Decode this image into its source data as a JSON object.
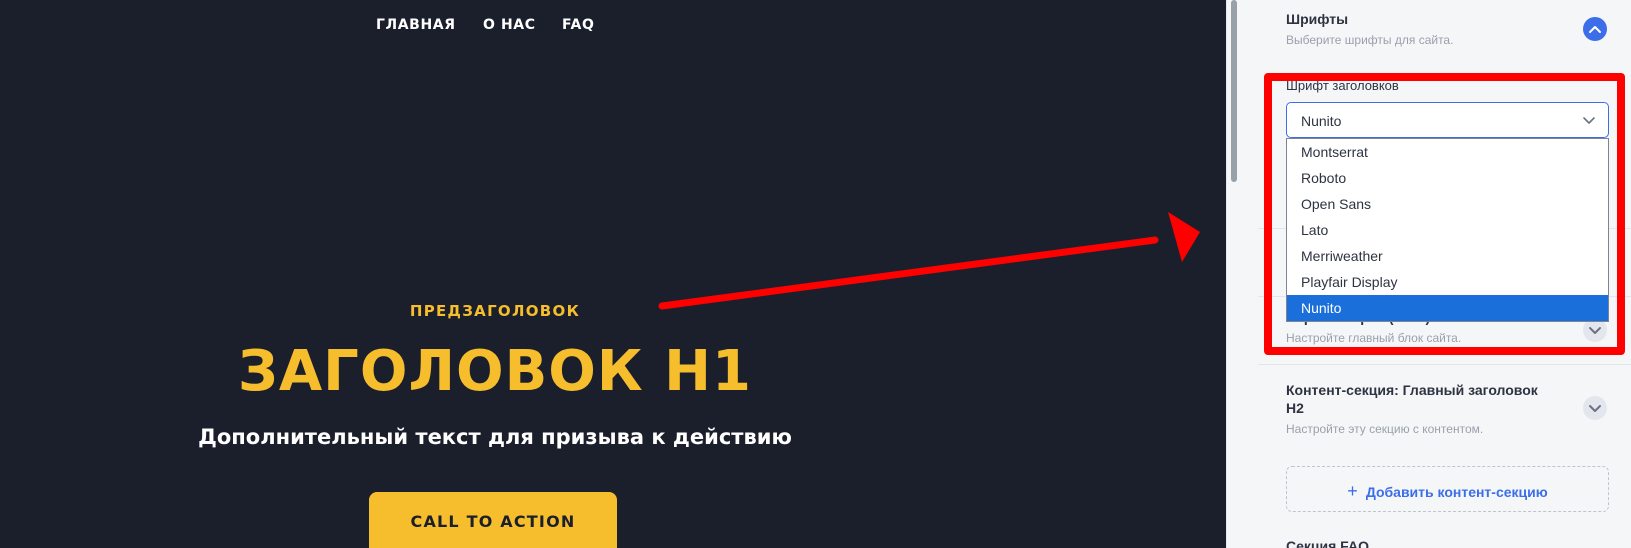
{
  "nav": {
    "items": [
      {
        "label": "ГЛАВНАЯ"
      },
      {
        "label": "О НАС"
      },
      {
        "label": "FAQ"
      }
    ]
  },
  "hero": {
    "pretitle": "ПРЕДЗАГОЛОВОК",
    "title": "ЗАГОЛОВОК H1",
    "subtitle": "Дополнительный текст для призыва к действию",
    "cta_label": "CALL TO ACTION"
  },
  "panel": {
    "fonts": {
      "title": "Шрифты",
      "description": "Выберите шрифты для сайта.",
      "heading_font_label": "Шрифт заголовков",
      "heading_font_value": "Nunito",
      "options": [
        "Montserrat",
        "Roboto",
        "Open Sans",
        "Lato",
        "Merriweather",
        "Playfair Display",
        "Nunito"
      ],
      "selected_option": "Nunito"
    },
    "hero_section": {
      "title": "Первый экран (Hero)",
      "description": "Настройте главный блок сайта."
    },
    "content_section": {
      "title_line1": "Контент-секция: Главный заголовок",
      "title_line2": "H2",
      "description": "Настройте эту секцию с контентом."
    },
    "add_content_section": "Добавить контент-секцию",
    "faq_section": {
      "title": "Секция FAQ"
    }
  },
  "colors": {
    "preview_background": "#1b1f2b",
    "accent_yellow": "#f6be2c",
    "panel_accent_blue": "#3b6ee8",
    "annotation_red": "#ff0000"
  },
  "icons": {
    "collapse": "chevron-up-icon",
    "expand": "chevron-down-icon",
    "select": "chevron-down-icon",
    "add": "plus-icon"
  }
}
